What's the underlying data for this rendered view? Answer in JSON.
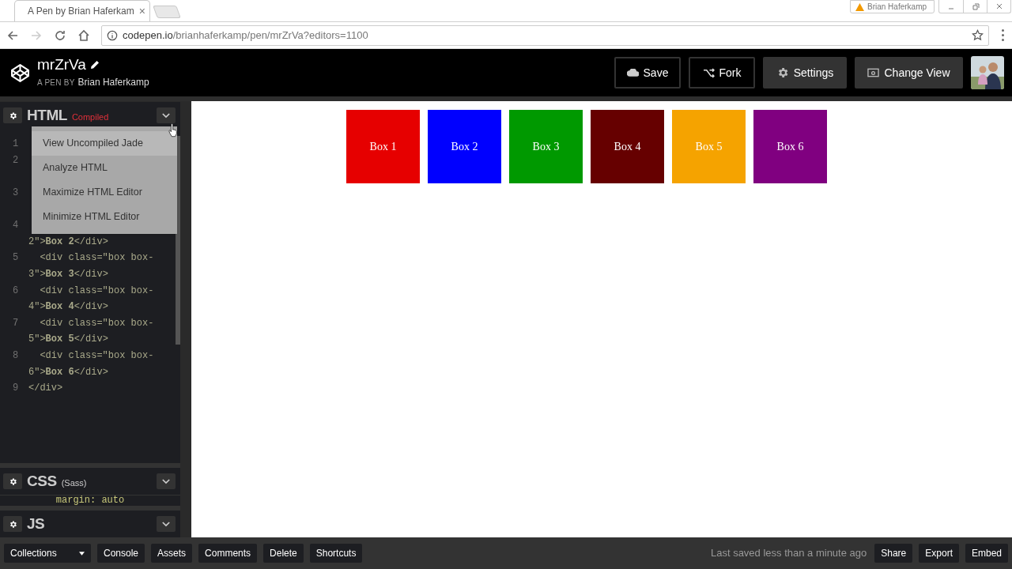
{
  "browser": {
    "tab_title": "A Pen by Brian Haferkam",
    "tab_close": "×",
    "profile": "Brian Haferkamp",
    "url_host": "codepen.io",
    "url_path": "/brianhaferkamp/pen/mrZrVa?editors=1100"
  },
  "header": {
    "pen_title": "mrZrVa",
    "byline_prefix": "A PEN BY",
    "author": "Brian Haferkamp",
    "buttons": [
      {
        "kind": "save",
        "label": "Save"
      },
      {
        "kind": "fork",
        "label": "Fork"
      },
      {
        "kind": "settings",
        "label": "Settings"
      },
      {
        "kind": "view",
        "label": "Change View"
      }
    ]
  },
  "html_editor": {
    "title": "HTML",
    "badge": "Compiled",
    "code_rows": [
      {
        "num": "1"
      },
      {
        "num": "2"
      },
      {},
      {
        "num": "3"
      },
      {},
      {
        "num": "4"
      },
      {
        "text": "2\">**Box 2**</div>"
      },
      {
        "num": "5",
        "text": "  <div class=\"box box-"
      },
      {
        "text": "3\">**Box 3**</div>"
      },
      {
        "num": "6",
        "text": "  <div class=\"box box-"
      },
      {
        "text": "4\">**Box 4**</div>"
      },
      {
        "num": "7",
        "text": "  <div class=\"box box-"
      },
      {
        "text": "5\">**Box 5**</div>"
      },
      {
        "num": "8",
        "text": "  <div class=\"box box-"
      },
      {
        "text": "6\">**Box 6**</div>"
      },
      {
        "num": "9",
        "text": "</div>"
      }
    ],
    "menu": [
      {
        "label": "View Uncompiled Jade",
        "selected": true
      },
      {
        "label": "Analyze HTML",
        "selected": false
      },
      {
        "label": "Maximize HTML Editor",
        "selected": false
      },
      {
        "label": "Minimize HTML Editor",
        "selected": false
      }
    ]
  },
  "css_editor": {
    "title": "CSS",
    "badge": "(Sass)",
    "code": "    margin: auto"
  },
  "js_editor": {
    "title": "JS"
  },
  "preview": {
    "boxes": [
      {
        "label": "Box 1",
        "color": "#e60000"
      },
      {
        "label": "Box 2",
        "color": "#0000ff"
      },
      {
        "label": "Box 3",
        "color": "#009900"
      },
      {
        "label": "Box 4",
        "color": "#660000"
      },
      {
        "label": "Box 5",
        "color": "#f5a300"
      },
      {
        "label": "Box 6",
        "color": "#800080"
      }
    ]
  },
  "footer": {
    "collections": "Collections",
    "left_buttons": [
      "Console",
      "Assets",
      "Comments",
      "Delete",
      "Shortcuts"
    ],
    "status": "Last saved less than a minute ago",
    "right_buttons": [
      "Share",
      "Export",
      "Embed"
    ]
  }
}
